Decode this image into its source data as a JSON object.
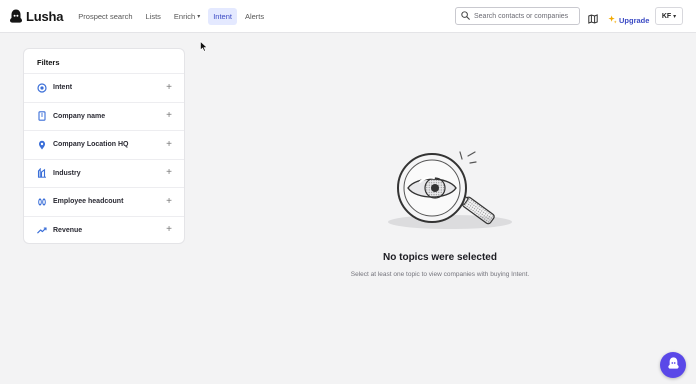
{
  "app": {
    "name": "Lusha"
  },
  "nav": {
    "items": [
      {
        "label": "Prospect search",
        "active": false
      },
      {
        "label": "Lists",
        "active": false
      },
      {
        "label": "Enrich",
        "active": false,
        "has_dropdown": true
      },
      {
        "label": "Intent",
        "active": true
      },
      {
        "label": "Alerts",
        "active": false
      }
    ]
  },
  "header": {
    "search": {
      "placeholder": "Search contacts or companies",
      "icon": "search-icon"
    },
    "map_icon": "map-icon",
    "upgrade_label": "Upgrade",
    "avatar_initials": "KF"
  },
  "filters": {
    "title": "Filters",
    "items": [
      {
        "label": "Intent",
        "icon": "target-icon"
      },
      {
        "label": "Company name",
        "icon": "building-icon"
      },
      {
        "label": "Company Location HQ",
        "icon": "location-pin-icon"
      },
      {
        "label": "Industry",
        "icon": "industry-icon"
      },
      {
        "label": "Employee headcount",
        "icon": "people-icon"
      },
      {
        "label": "Revenue",
        "icon": "trend-icon"
      }
    ],
    "add_symbol": "+"
  },
  "empty_state": {
    "title": "No topics were selected",
    "subtitle": "Select at least one topic to view companies with buying Intent."
  },
  "colors": {
    "accent": "#3b4ac4",
    "chat_button": "#5a48e8",
    "background": "#f3f3f4"
  }
}
